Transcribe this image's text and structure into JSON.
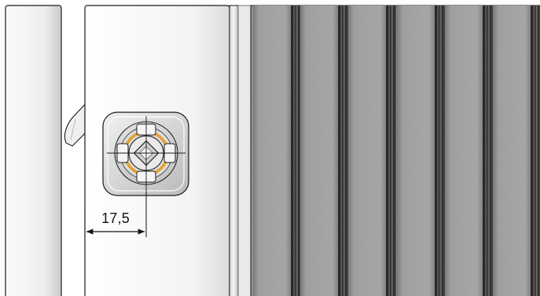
{
  "dimension": {
    "value_label": "17,5"
  },
  "components": {
    "left_strip": "panel-edge",
    "door_panel": "door-panel",
    "hinge": "hinge-tab",
    "lock": "quarter-turn-lock",
    "ribbed_panel": "ribbed-side-panel"
  },
  "colors": {
    "background": "#ffffff",
    "panel_light": "#f4f4f4",
    "panel_outline": "#1a1a1a",
    "ribbed_base": "#8e8e8e",
    "ribbed_dark": "#3a3a3a",
    "lock_ring": "#e2a12c",
    "lock_body": "#e6e6e6"
  }
}
